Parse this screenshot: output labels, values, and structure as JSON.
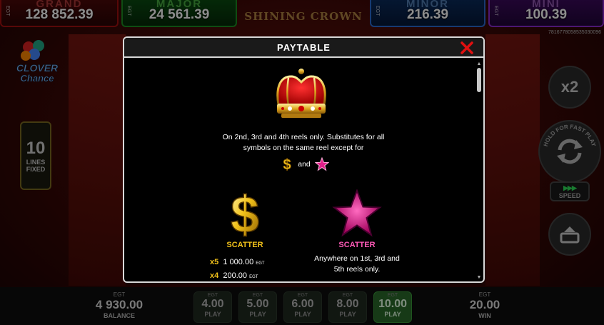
{
  "jackpots": {
    "grand": {
      "name": "GRAND",
      "value": "128 852.39",
      "prefix": "EGT"
    },
    "major": {
      "name": "MAJOR",
      "value": "24 561.39",
      "prefix": "EGT"
    },
    "minor": {
      "name": "MINOR",
      "value": "216.39",
      "prefix": "EGT"
    },
    "mini": {
      "name": "MINI",
      "value": "100.39",
      "prefix": "EGT"
    }
  },
  "game": {
    "title": "SHINING CROWN",
    "id": "7816778058535030096",
    "logo_line1": "CLOVER",
    "logo_line2": "Chance",
    "lines_number": "10",
    "lines_label_1": "LINES",
    "lines_label_2": "FIXED",
    "x2_label": "x2",
    "hold_text": "HOLD FOR FAST PLAY",
    "speed_label": "SPEED",
    "speed_arrows": "▶▶▶"
  },
  "paytable": {
    "title": "PAYTABLE",
    "wild_description": "On 2nd, 3rd and 4th reels only. Substitutes for all symbols on the same reel except for",
    "and_text": "and",
    "dollar_scatter": {
      "label": "SCATTER",
      "payouts": [
        {
          "multiplier": "x5",
          "amount": "1 000.00",
          "currency": "EGT"
        },
        {
          "multiplier": "x4",
          "amount": "200.00",
          "currency": "EGT"
        }
      ]
    },
    "star_scatter": {
      "label": "SCATTER",
      "description": "Anywhere on 1st, 3rd and 5th reels only."
    }
  },
  "bottom_bar": {
    "balance": {
      "top": "EGT",
      "value": "4 930.00",
      "label": "BALANCE"
    },
    "win": {
      "top": "EGT",
      "value": "20.00",
      "label": "WIN"
    },
    "bets": [
      {
        "egt": "EGT",
        "value": "4.00",
        "label": "PLAY"
      },
      {
        "egt": "EGT",
        "value": "5.00",
        "label": "PLAY"
      },
      {
        "egt": "EGT",
        "value": "6.00",
        "label": "PLAY"
      },
      {
        "egt": "EGT",
        "value": "8.00",
        "label": "PLAY"
      },
      {
        "egt": "EGT",
        "value": "10.00",
        "label": "PLAY",
        "active": true
      }
    ]
  },
  "colors": {
    "scatter_gold": "#f2c21a",
    "scatter_pink": "#ff5ab8",
    "close_red": "#e01010",
    "active_bet": "#2a6a2a"
  }
}
